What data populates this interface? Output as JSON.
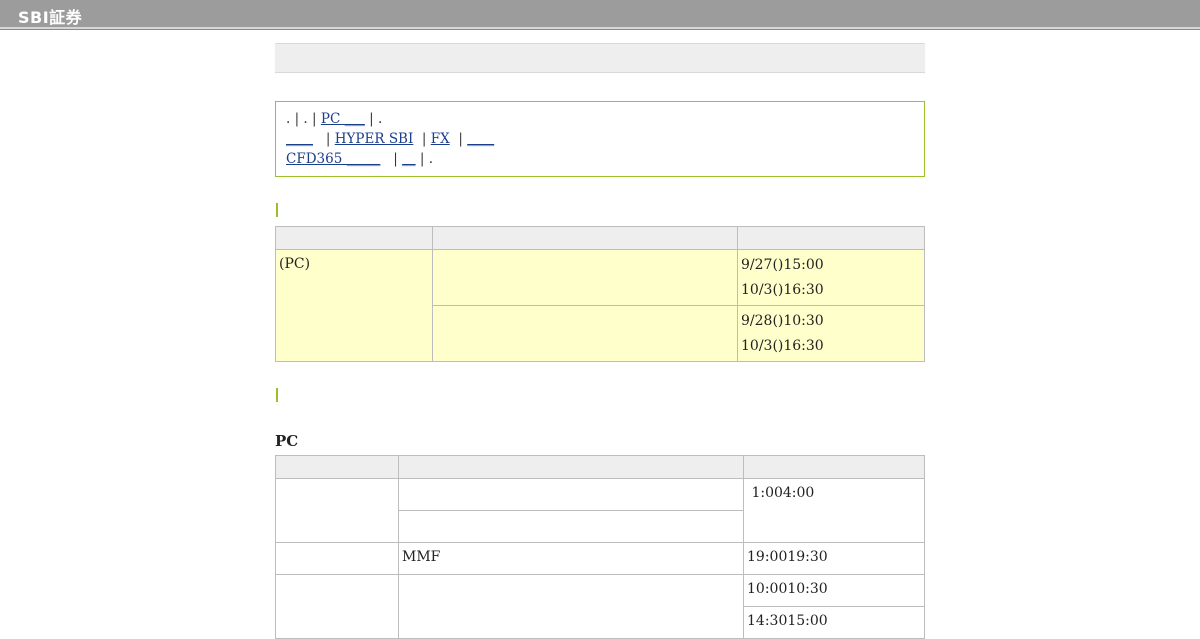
{
  "header": {
    "logo_text": "SBI証券"
  },
  "notice": {
    "line1": {
      "prefix": ". | . |",
      "link": "PC ___",
      "suffix": "| ."
    },
    "line2": {
      "link1": "____",
      "link2": "HYPER SBI",
      "link3": "FX",
      "link4": "____"
    },
    "line3": {
      "link1": "CFD365 _____",
      "link2": "__",
      "suffix": "| ."
    }
  },
  "table1": {
    "headers": [
      "",
      "",
      ""
    ],
    "rows": [
      {
        "category": "(PC)",
        "sub": "",
        "time_start": "9/27()15:00",
        "time_end": "10/3()16:30"
      },
      {
        "sub": "",
        "time_start": "9/28()10:30",
        "time_end": "10/3()16:30"
      }
    ]
  },
  "section2": {
    "title": "PC"
  },
  "table2": {
    "headers": [
      "",
      "",
      ""
    ],
    "rows": [
      {
        "col1": "",
        "col2": "",
        "col3": " 1:004:00"
      },
      {
        "col2": ""
      },
      {
        "col1": "",
        "col2": "MMF",
        "col3": "19:0019:30"
      },
      {
        "col1": "",
        "col2": "",
        "col3": "10:0010:30"
      },
      {
        "col3": "14:3015:00"
      }
    ]
  },
  "colors": {
    "accent": "#9cbf2a",
    "highlight": "#ffffcc",
    "header_bg": "#eeeeee",
    "link": "#1a3e8c"
  }
}
